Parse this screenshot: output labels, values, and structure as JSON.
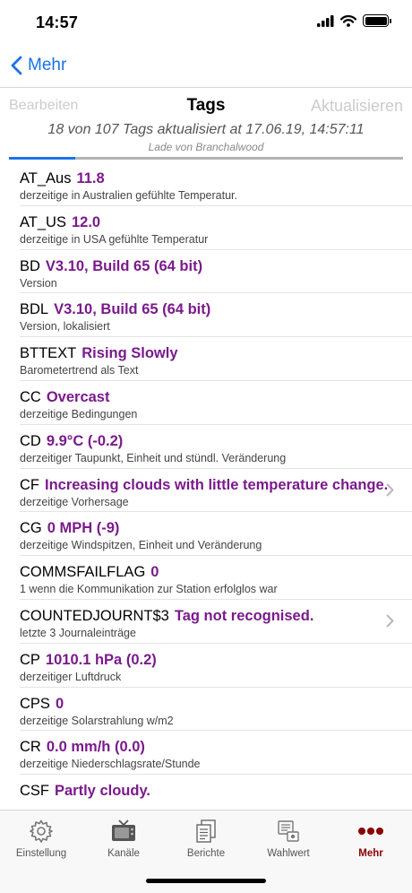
{
  "status_bar": {
    "time": "14:57"
  },
  "nav": {
    "back_label": "Mehr"
  },
  "toolbar": {
    "edit_label": "Bearbeiten",
    "title": "Tags",
    "refresh_label": "Aktualisieren"
  },
  "summary": "18 von 107 Tags aktualisiert at 17.06.19, 14:57:11",
  "loading": "Lade von Branchalwood",
  "progress": {
    "fraction": 0.168
  },
  "colors": {
    "accent": "#1a73e8",
    "value": "#7a1a8c",
    "active_tab": "#8b0000"
  },
  "tags": [
    {
      "key": "AT_Aus",
      "value": "11.8",
      "desc": "derzeitige in Australien gefühlte Temperatur.",
      "chevron": false
    },
    {
      "key": "AT_US",
      "value": "12.0",
      "desc": "derzeitige in USA gefühlte Temperatur",
      "chevron": false
    },
    {
      "key": "BD",
      "value": "V3.10, Build 65 (64 bit)",
      "desc": "Version",
      "chevron": false
    },
    {
      "key": "BDL",
      "value": "V3.10, Build 65 (64 bit)",
      "desc": "Version, lokalisiert",
      "chevron": false
    },
    {
      "key": "BTTEXT",
      "value": "Rising Slowly",
      "desc": "Barometertrend als Text",
      "chevron": false
    },
    {
      "key": "CC",
      "value": "Overcast",
      "desc": "derzeitige Bedingungen",
      "chevron": false
    },
    {
      "key": "CD",
      "value": "9.9°C (-0.2)",
      "desc": "derzeitiger Taupunkt, Einheit und stündl. Veränderung",
      "chevron": false
    },
    {
      "key": "CF",
      "value": "Increasing clouds with little temperature change.",
      "desc": "derzeitige Vorhersage",
      "chevron": true
    },
    {
      "key": "CG",
      "value": "0 MPH (-9)",
      "desc": "derzeitige Windspitzen, Einheit und Veränderung",
      "chevron": false
    },
    {
      "key": "COMMSFAILFLAG",
      "value": "0",
      "desc": "1 wenn die Kommunikation zur Station erfolglos war",
      "chevron": false
    },
    {
      "key": "COUNTEDJOURNT$3",
      "value": "Tag not recognised.",
      "desc": "letzte 3 Journaleinträge",
      "chevron": true
    },
    {
      "key": "CP",
      "value": "1010.1 hPa (0.2)",
      "desc": "derzeitiger Luftdruck",
      "chevron": false
    },
    {
      "key": "CPS",
      "value": "0",
      "desc": "derzeitige Solarstrahlung w/m2",
      "chevron": false
    },
    {
      "key": "CR",
      "value": "0.0 mm/h (0.0)",
      "desc": "derzeitige Niederschlagsrate/Stunde",
      "chevron": false
    },
    {
      "key": "CSF",
      "value": "Partly cloudy.",
      "desc": "",
      "chevron": false
    }
  ],
  "tabs": [
    {
      "label": "Einstellung",
      "icon": "gear-icon",
      "active": false
    },
    {
      "label": "Kanäle",
      "icon": "tv-icon",
      "active": false
    },
    {
      "label": "Berichte",
      "icon": "documents-icon",
      "active": false
    },
    {
      "label": "Wahlwert",
      "icon": "selection-icon",
      "active": false
    },
    {
      "label": "Mehr",
      "icon": "more-dots-icon",
      "active": true
    }
  ]
}
